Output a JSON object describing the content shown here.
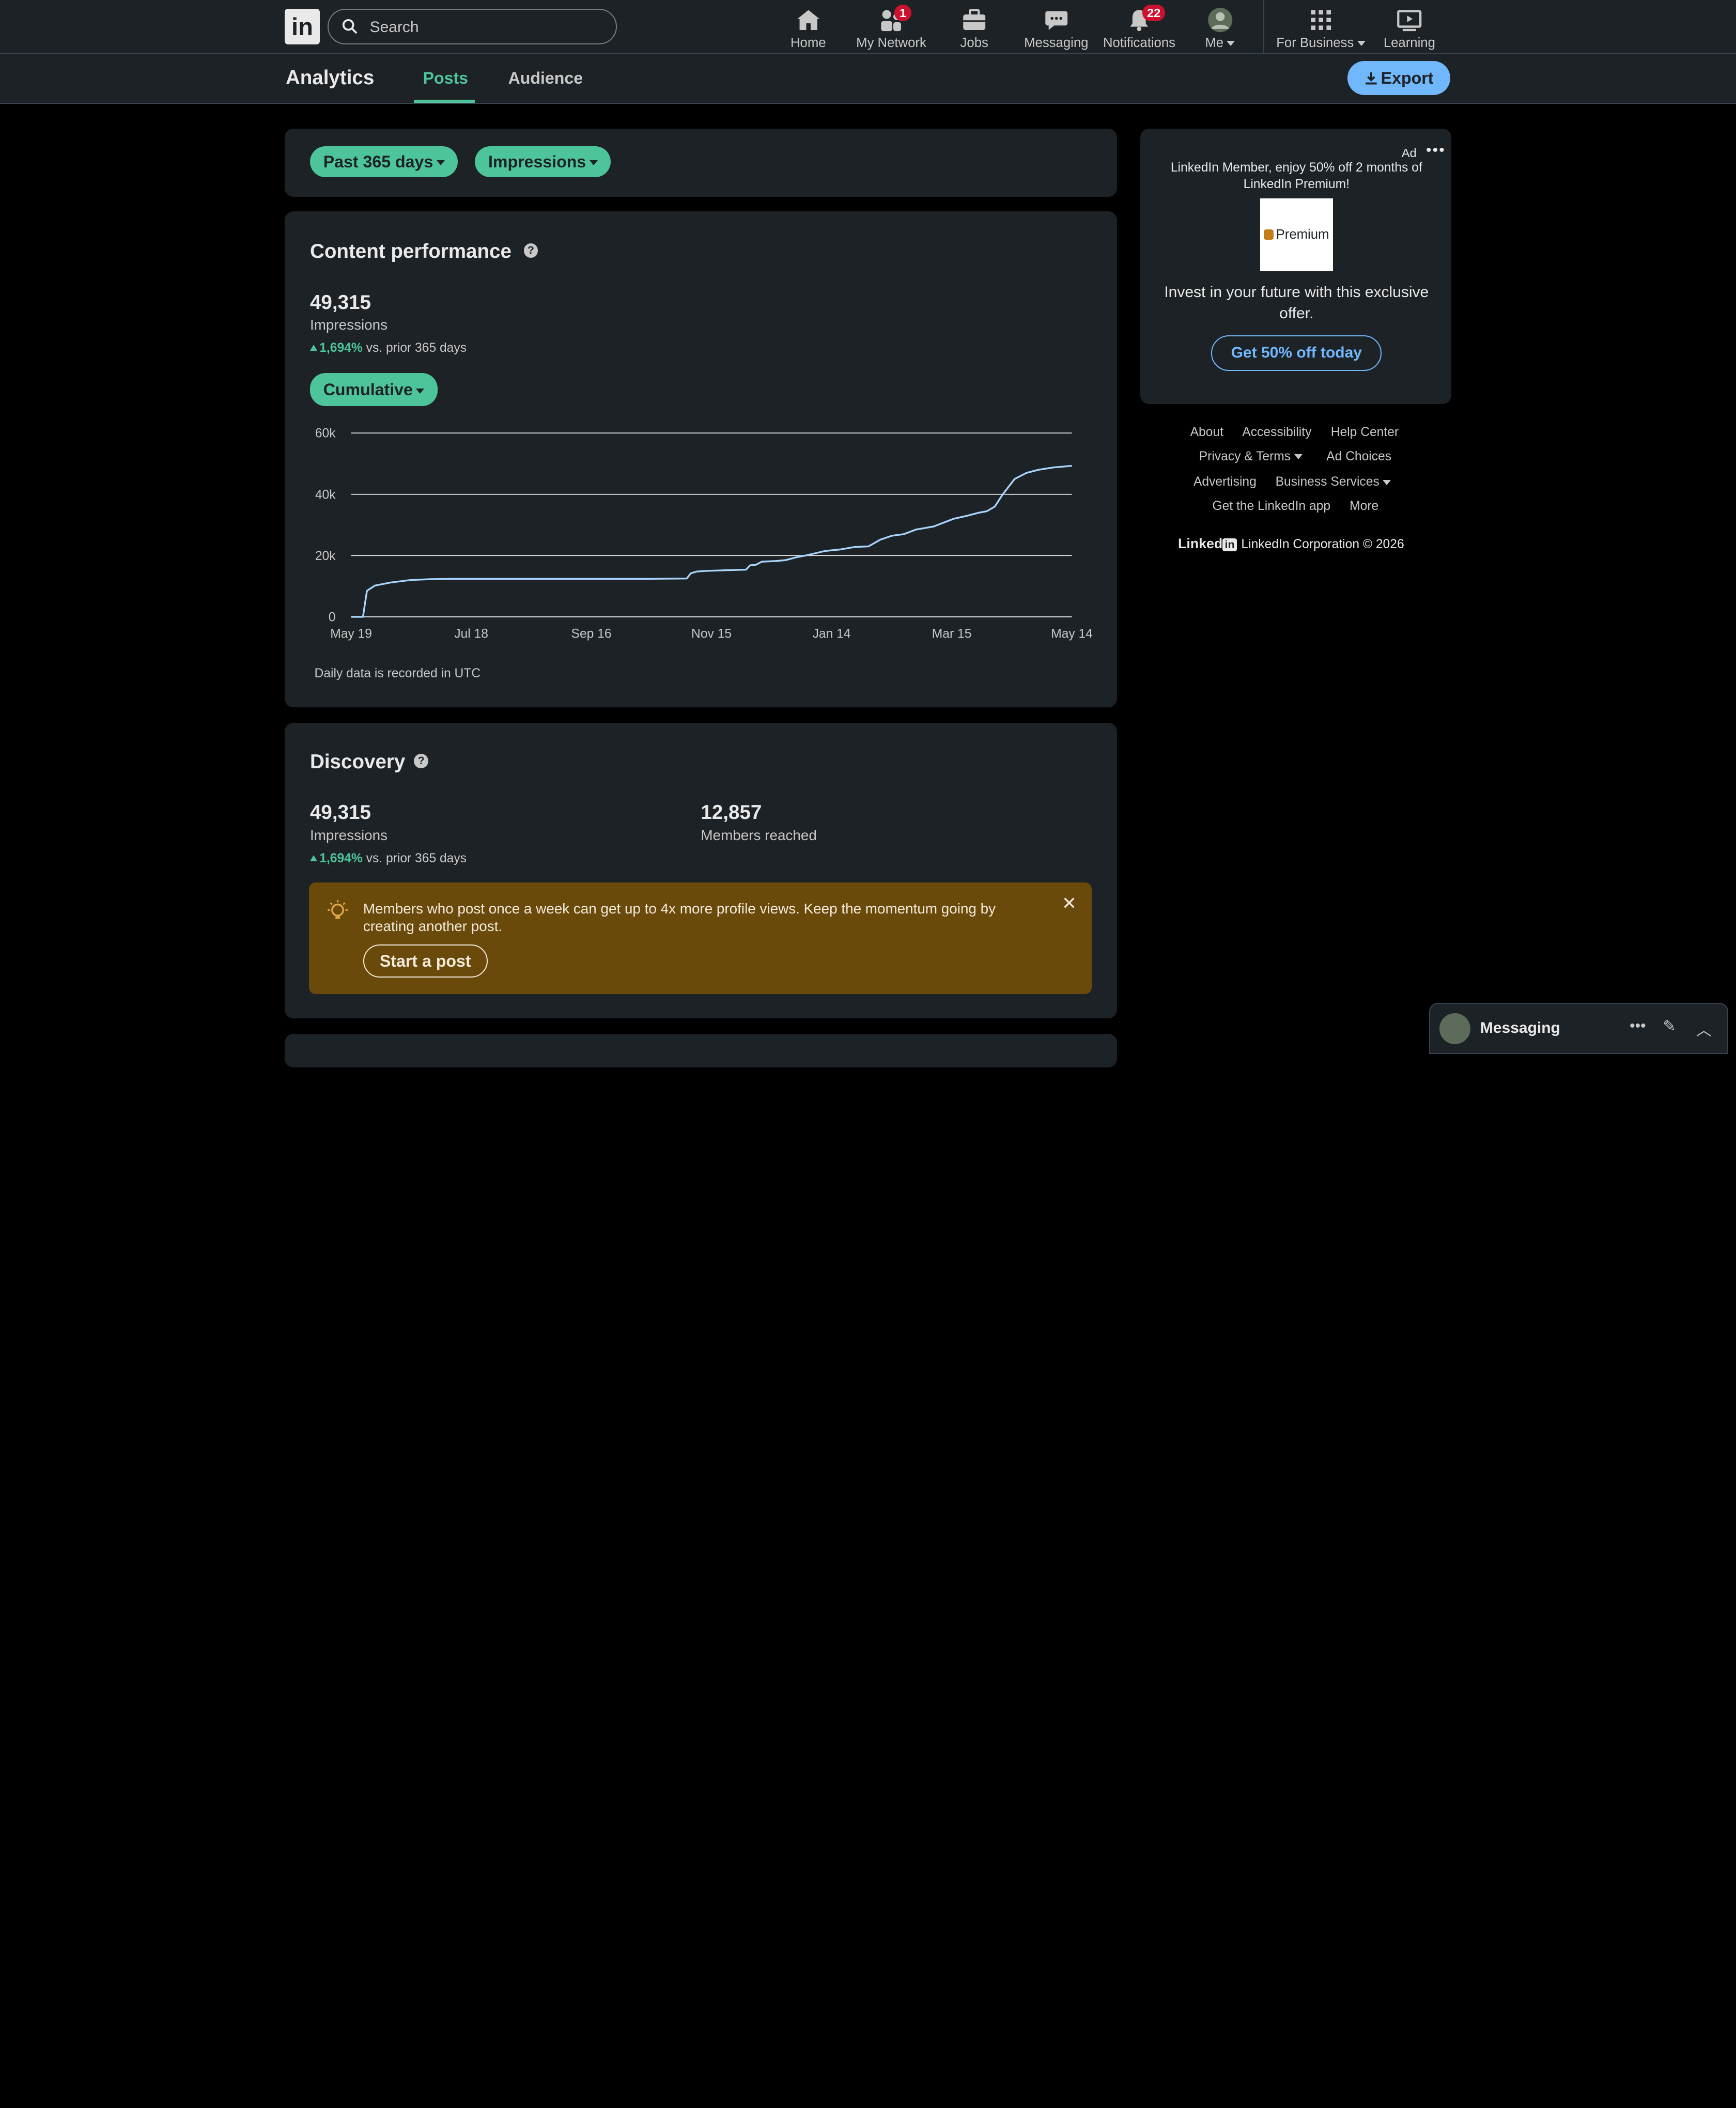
{
  "topnav": {
    "logo": "in",
    "search_placeholder": "Search",
    "items": [
      {
        "label": "Home"
      },
      {
        "label": "My Network",
        "badge": "1"
      },
      {
        "label": "Jobs"
      },
      {
        "label": "Messaging"
      },
      {
        "label": "Notifications",
        "badge": "22"
      },
      {
        "label": "Me"
      },
      {
        "label": "For Business"
      },
      {
        "label": "Learning"
      }
    ]
  },
  "subnav": {
    "title": "Analytics",
    "tabs": [
      {
        "label": "Posts",
        "active": true
      },
      {
        "label": "Audience",
        "active": false
      }
    ],
    "export_label": "Export"
  },
  "filters": {
    "range": "Past 365 days",
    "metric": "Impressions"
  },
  "content_performance": {
    "title": "Content performance",
    "help": "?",
    "value": "49,315",
    "label": "Impressions",
    "delta": "1,694%",
    "delta_suffix": "vs. prior 365 days",
    "mode": "Cumulative",
    "note": "Daily data is recorded in UTC"
  },
  "chart_data": {
    "type": "line",
    "x_ticks": [
      "May 19",
      "Jul 18",
      "Sep 16",
      "Nov 15",
      "Jan 14",
      "Mar 15",
      "May 14"
    ],
    "y_ticks": [
      "0",
      "20k",
      "40k",
      "60k"
    ],
    "ylim": [
      0,
      60000
    ],
    "grid": true,
    "series": [
      {
        "color": "#a8d4fb",
        "x": [
          0,
          6,
          8,
          12,
          20,
          30,
          40,
          50,
          60,
          100,
          150,
          170,
          172,
          175,
          180,
          190,
          200,
          202,
          205,
          208,
          215,
          220,
          226,
          230,
          240,
          248,
          255,
          262,
          268,
          274,
          280,
          286,
          295,
          305,
          312,
          318,
          322,
          326,
          330,
          336,
          342,
          348,
          356,
          360,
          365
        ],
        "y": [
          0,
          0,
          8500,
          10200,
          11200,
          12000,
          12300,
          12400,
          12400,
          12400,
          12400,
          12500,
          14200,
          14800,
          15000,
          15200,
          15400,
          16800,
          17000,
          18000,
          18200,
          18500,
          19500,
          20000,
          21500,
          22000,
          22800,
          23000,
          25200,
          26500,
          27000,
          28500,
          29500,
          32000,
          33000,
          34000,
          34500,
          36000,
          40000,
          45000,
          47000,
          48000,
          48800,
          49000,
          49315
        ]
      }
    ]
  },
  "discovery": {
    "title": "Discovery",
    "help": "?",
    "impressions_value": "49,315",
    "impressions_label": "Impressions",
    "delta": "1,694%",
    "delta_suffix": "vs. prior 365 days",
    "reached_value": "12,857",
    "reached_label": "Members reached",
    "tip_text": "Members who post once a week can get up to 4x more profile views. Keep the momentum going by creating another post.",
    "tip_button": "Start a post"
  },
  "ad": {
    "label": "Ad",
    "headline": "LinkedIn Member, enjoy 50% off 2 months of LinkedIn Premium!",
    "image_text": "Premium",
    "body": "Invest in your future with this exclusive offer.",
    "cta": "Get 50% off today"
  },
  "footer": {
    "links": [
      "About",
      "Accessibility",
      "Help Center",
      "Privacy & Terms",
      "Ad Choices",
      "Advertising",
      "Business Services",
      "Get the LinkedIn app",
      "More"
    ],
    "brand": "Linked",
    "brand_in": "in",
    "corp": "LinkedIn Corporation © 2026"
  },
  "messaging_bar": {
    "label": "Messaging"
  },
  "colors": {
    "accent": "#4dc49a",
    "link": "#71b7fb",
    "bg": "#000000",
    "card": "#1d2226",
    "tip": "#6a4a0b",
    "badge": "#cb112d"
  }
}
